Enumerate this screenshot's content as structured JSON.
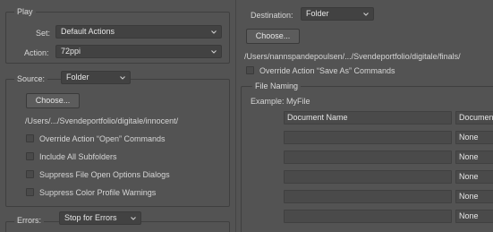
{
  "play": {
    "legend": "Play",
    "set_label": "Set:",
    "set_value": "Default Actions",
    "action_label": "Action:",
    "action_value": "72ppi"
  },
  "source": {
    "label": "Source:",
    "value": "Folder",
    "choose_button": "Choose...",
    "path": "/Users/.../Svendeportfolio/digitale/innocent/",
    "options": [
      "Override Action “Open” Commands",
      "Include All Subfolders",
      "Suppress File Open Options Dialogs",
      "Suppress Color Profile Warnings"
    ]
  },
  "errors": {
    "label": "Errors:",
    "value": "Stop for Errors"
  },
  "destination": {
    "label": "Destination:",
    "value": "Folder",
    "choose_button": "Choose...",
    "path": "/Users/nannspandepoulsen/.../Svendeportfolio/digitale/finals/",
    "override_label": "Override Action “Save As” Commands"
  },
  "file_naming": {
    "legend": "File Naming",
    "example": "Example: MyFile",
    "rows": [
      {
        "name": "Document Name",
        "ext": "Documen"
      },
      {
        "name": "",
        "ext": "None"
      },
      {
        "name": "",
        "ext": "None"
      },
      {
        "name": "",
        "ext": "None"
      },
      {
        "name": "",
        "ext": "None"
      },
      {
        "name": "",
        "ext": "None"
      }
    ]
  }
}
